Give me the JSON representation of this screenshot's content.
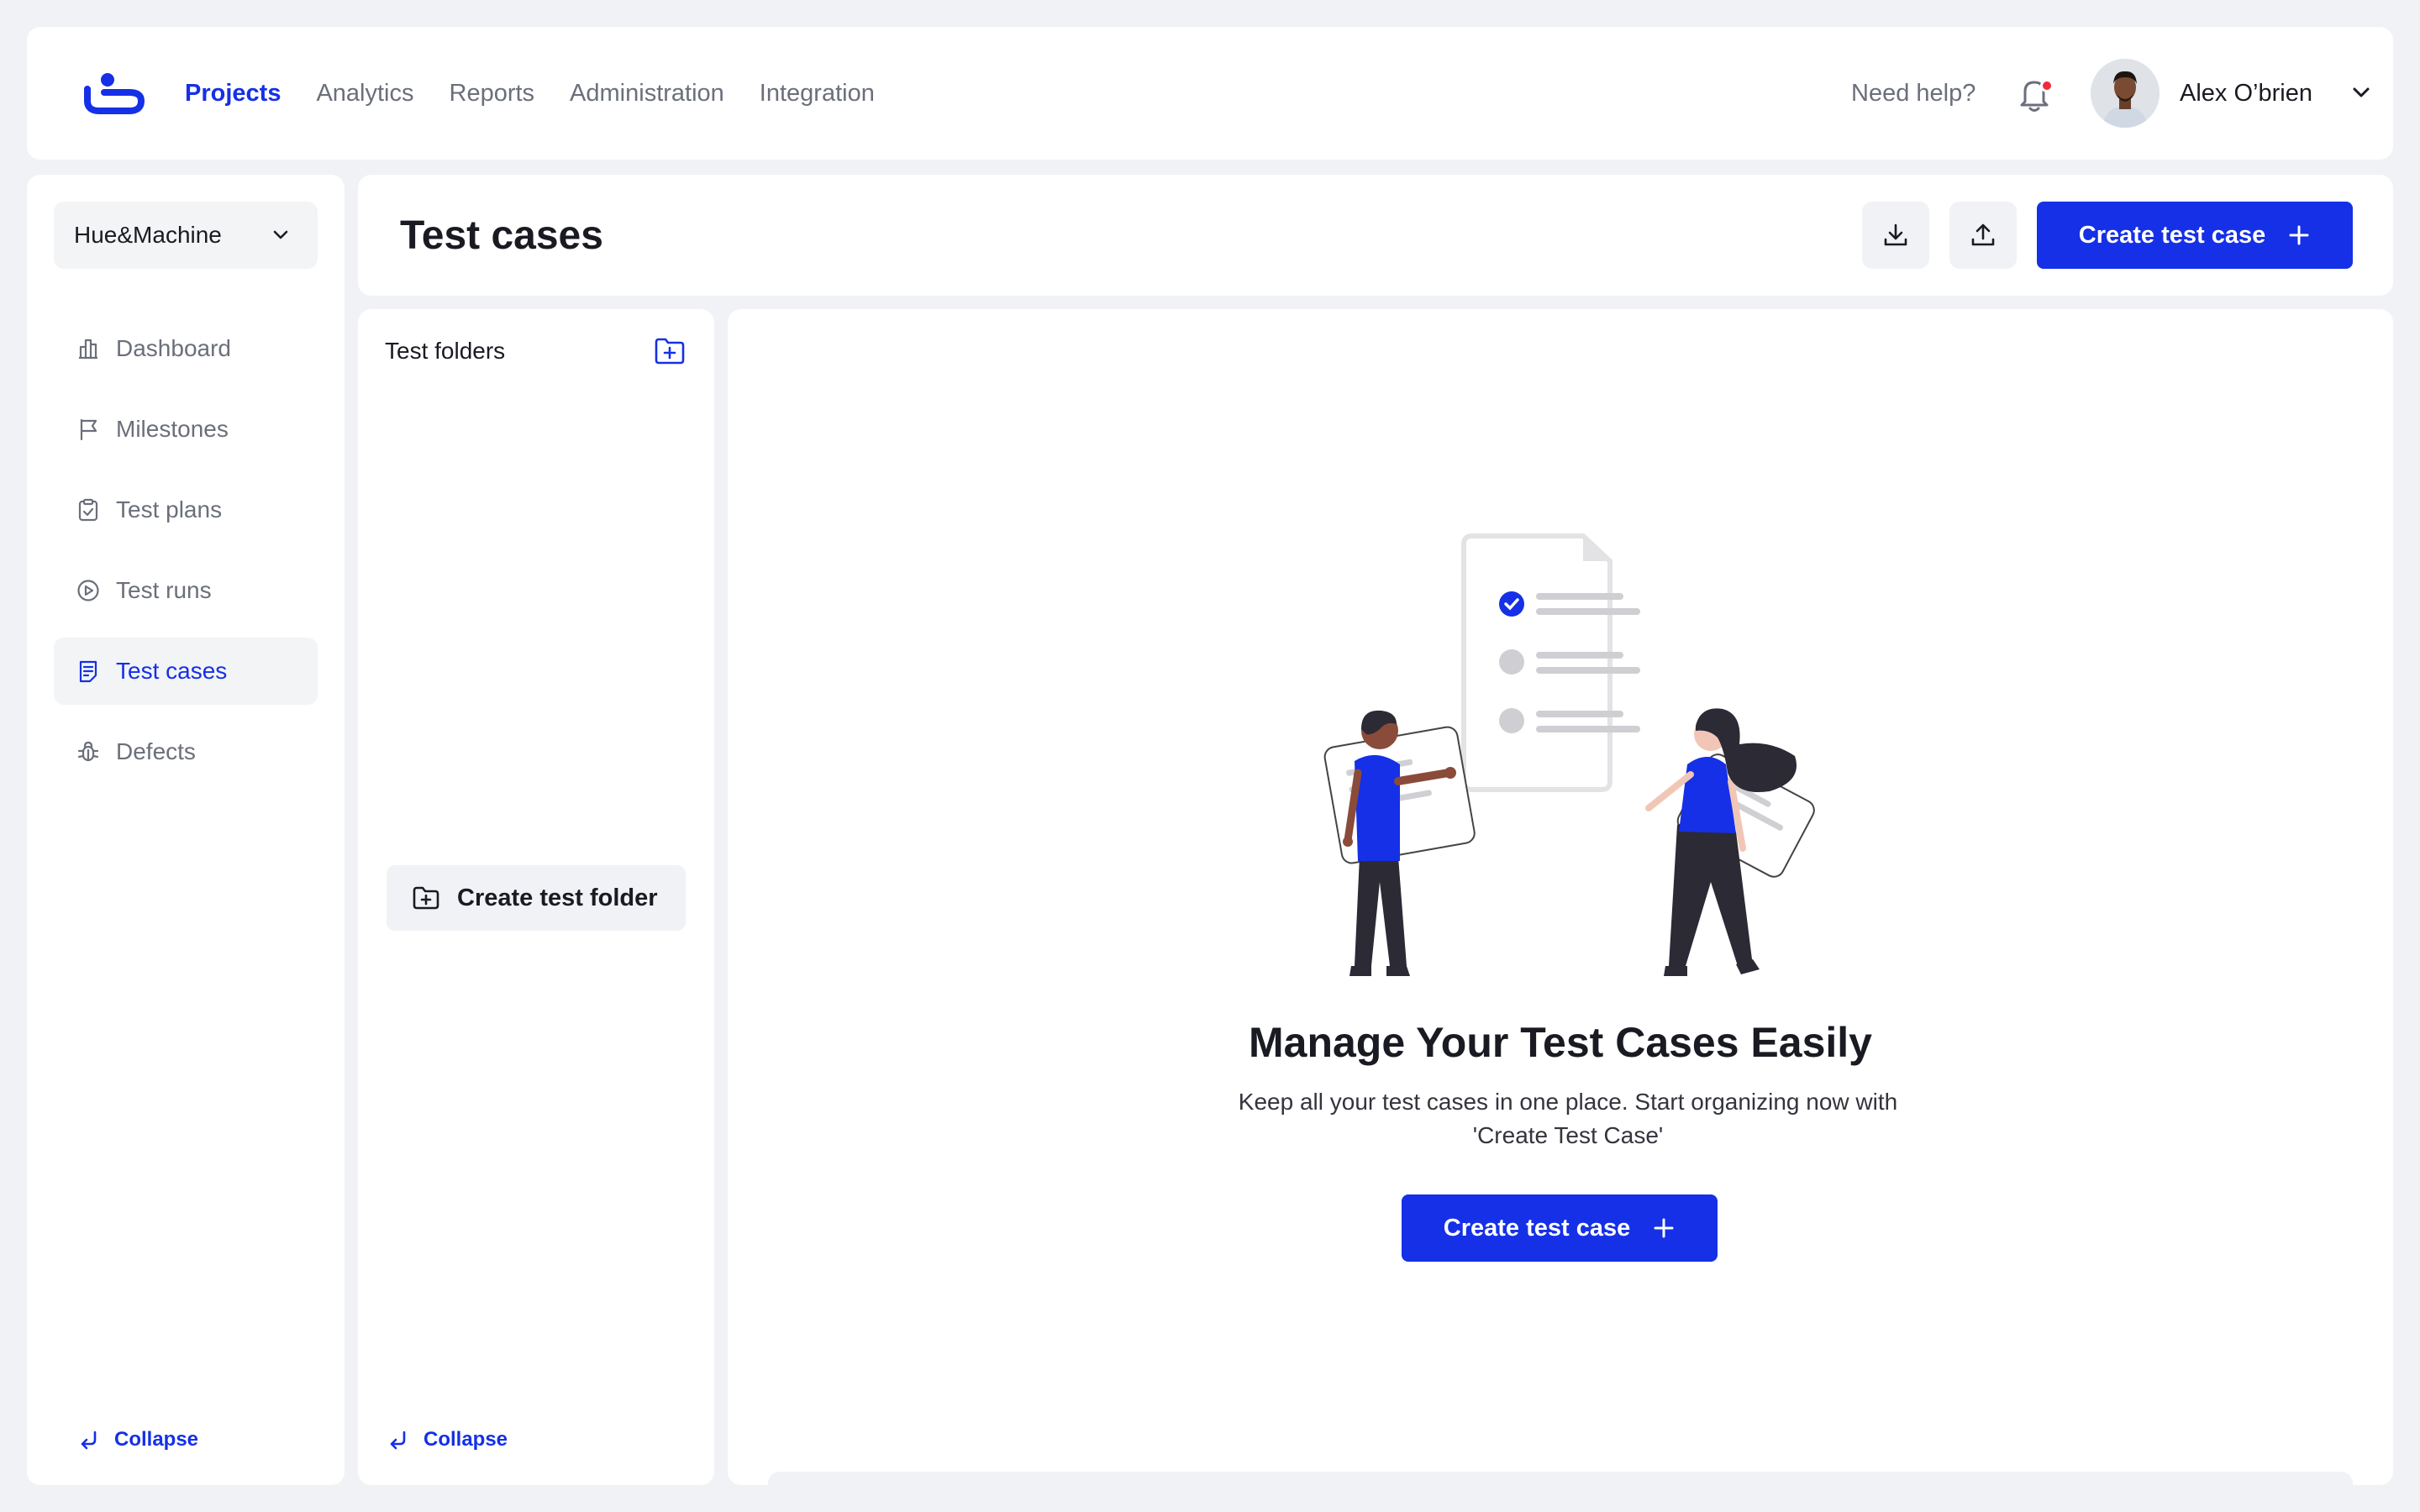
{
  "topbar": {
    "nav": [
      "Projects",
      "Analytics",
      "Reports",
      "Administration",
      "Integration"
    ],
    "active_nav": "Projects",
    "help_label": "Need help?",
    "user_name": "Alex O’brien",
    "has_notification": true
  },
  "sidebar": {
    "project": "Hue&Machine",
    "items": [
      {
        "label": "Dashboard",
        "icon": "dashboard-icon"
      },
      {
        "label": "Milestones",
        "icon": "flag-icon"
      },
      {
        "label": "Test plans",
        "icon": "clipboard-check-icon"
      },
      {
        "label": "Test runs",
        "icon": "play-circle-icon"
      },
      {
        "label": "Test cases",
        "icon": "test-case-icon",
        "active": true
      },
      {
        "label": "Defects",
        "icon": "bug-icon"
      }
    ],
    "collapse_label": "Collapse"
  },
  "header": {
    "title": "Test cases",
    "create_label": "Create test case"
  },
  "folders": {
    "title": "Test folders",
    "create_folder_label": "Create test folder",
    "collapse_label": "Collapse"
  },
  "empty_state": {
    "title": "Manage Your Test Cases Easily",
    "subtitle": "Keep all your test cases in one place. Start organizing now with 'Create Test Case'",
    "button_label": "Create test case"
  },
  "colors": {
    "primary": "#1530e6",
    "background": "#f1f2f5",
    "notification": "#ef2b3c"
  }
}
